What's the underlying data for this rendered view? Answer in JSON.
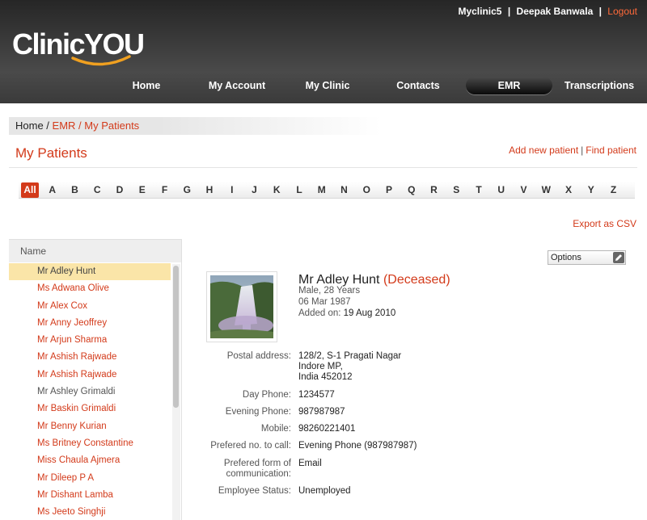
{
  "topbar": {
    "clinic": "Myclinic5",
    "user": "Deepak Banwala",
    "logout": "Logout",
    "sep": "|"
  },
  "brand": {
    "logo": "ClinicYOU"
  },
  "nav": [
    {
      "label": "Home"
    },
    {
      "label": "My Account"
    },
    {
      "label": "My Clinic"
    },
    {
      "label": "Contacts"
    },
    {
      "label": "EMR"
    },
    {
      "label": "Transcriptions"
    }
  ],
  "breadcrumb": {
    "home": "Home",
    "sep1": " / ",
    "emr": "EMR",
    "sep2": " / ",
    "current": "My Patients"
  },
  "page": {
    "title": "My Patients",
    "add_link": "Add new patient",
    "find_link": "Find patient",
    "sep": "|",
    "export": "Export as CSV"
  },
  "alphabet": [
    "All",
    "A",
    "B",
    "C",
    "D",
    "E",
    "F",
    "G",
    "H",
    "I",
    "J",
    "K",
    "L",
    "M",
    "N",
    "O",
    "P",
    "Q",
    "R",
    "S",
    "T",
    "U",
    "V",
    "W",
    "X",
    "Y",
    "Z"
  ],
  "list": {
    "header": "Name",
    "patients": [
      "Mr Adley Hunt",
      "Ms Adwana Olive",
      "Mr Alex Cox",
      "Mr Anny Jeoffrey",
      "Mr Arjun Sharma",
      "Mr Ashish Rajwade",
      "Mr Ashish Rajwade",
      "Mr Ashley Grimaldi",
      "Mr Baskin Grimaldi",
      "Mr Benny Kurian",
      "Ms Britney Constantine",
      "Miss Chaula Ajmera",
      "Mr Dileep P A",
      "Mr Dishant Lamba",
      "Ms Jeeto Singhji"
    ]
  },
  "details": {
    "options": "Options",
    "name": "Mr Adley Hunt",
    "status": "(Deceased)",
    "gender_age": "Male, 28 Years",
    "dob": "06 Mar 1987",
    "added_label": "Added on:",
    "added_value": "19 Aug 2010",
    "postal_label": "Postal address:",
    "postal_1": "128/2, S-1 Pragati Nagar",
    "postal_2": "Indore MP,",
    "postal_3": "India 452012",
    "day_label": "Day Phone:",
    "day_value": "1234577",
    "evening_label": "Evening Phone:",
    "evening_value": "987987987",
    "mobile_label": "Mobile:",
    "mobile_value": "98260221401",
    "pref_call_label": "Prefered no. to call:",
    "pref_call_value": "Evening Phone (987987987)",
    "pref_comm_label_1": "Prefered form of",
    "pref_comm_label_2": "communication:",
    "pref_comm_value": "Email",
    "employee_label": "Employee Status:",
    "employee_value": "Unemployed"
  }
}
